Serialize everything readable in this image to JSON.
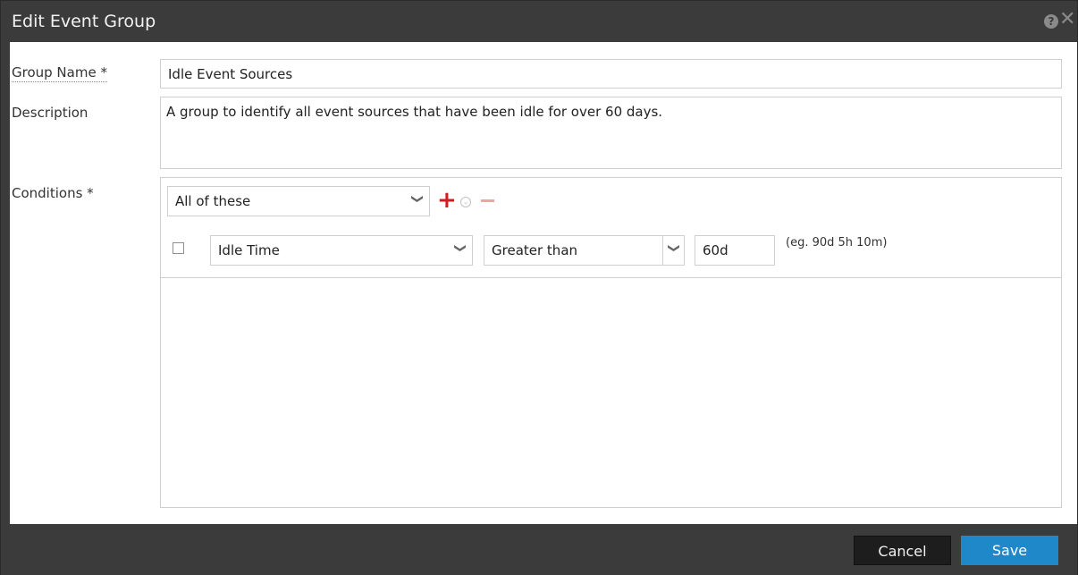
{
  "dialog": {
    "title": "Edit Event Group",
    "help_icon": "question-circle-icon",
    "close_icon": "close-icon"
  },
  "form": {
    "group_name_label": "Group Name *",
    "group_name_value": "Idle Event Sources",
    "description_label": "Description",
    "description_value": "A group to identify all event sources that have been idle for over 60 days.",
    "conditions_label": "Conditions *"
  },
  "conditions": {
    "match_selector": "All of these",
    "add_icon": "plus-icon",
    "menu_icon": "chevron-circle-icon",
    "remove_icon": "minus-icon",
    "rules": [
      {
        "checked": false,
        "field": "Idle Time",
        "operator": "Greater than",
        "value": "60d",
        "hint": "(eg. 90d 5h 10m)"
      }
    ]
  },
  "footer": {
    "cancel_label": "Cancel",
    "save_label": "Save"
  },
  "colors": {
    "chrome": "#3b3b3b",
    "primary_button": "#1f88c9",
    "add_icon": "#cc1f1f",
    "remove_icon": "#f0a3a3"
  }
}
